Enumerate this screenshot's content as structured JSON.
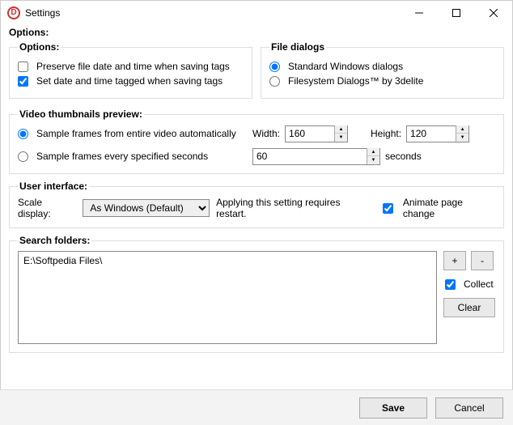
{
  "window": {
    "title": "Settings"
  },
  "heading": "Options:",
  "options_group": {
    "legend": "Options:",
    "preserve_label": "Preserve file date and time when saving tags",
    "preserve_checked": false,
    "setdate_label": "Set date and time tagged when saving tags",
    "setdate_checked": true
  },
  "file_dialogs_group": {
    "legend": "File dialogs",
    "standard_label": "Standard Windows dialogs",
    "filesystem_label": "Filesystem Dialogs™ by 3delite",
    "selected": "standard"
  },
  "video_group": {
    "legend": "Video thumbnails preview:",
    "auto_label": "Sample frames from entire video automatically",
    "seconds_label": "Sample frames every specified seconds",
    "selected": "auto",
    "width_label": "Width:",
    "width_value": "160",
    "height_label": "Height:",
    "height_value": "120",
    "seconds_value": "60",
    "seconds_unit": "seconds"
  },
  "ui_group": {
    "legend": "User interface:",
    "scale_label": "Scale display:",
    "scale_value": "As Windows (Default)",
    "restart_note": "Applying this setting requires restart.",
    "animate_label": "Animate page change",
    "animate_checked": true
  },
  "search_group": {
    "legend": "Search folders:",
    "folders": [
      "E:\\Softpedia Files\\"
    ],
    "add_label": "+",
    "remove_label": "-",
    "collect_label": "Collect",
    "collect_checked": true,
    "clear_label": "Clear"
  },
  "footer": {
    "save_label": "Save",
    "cancel_label": "Cancel"
  }
}
